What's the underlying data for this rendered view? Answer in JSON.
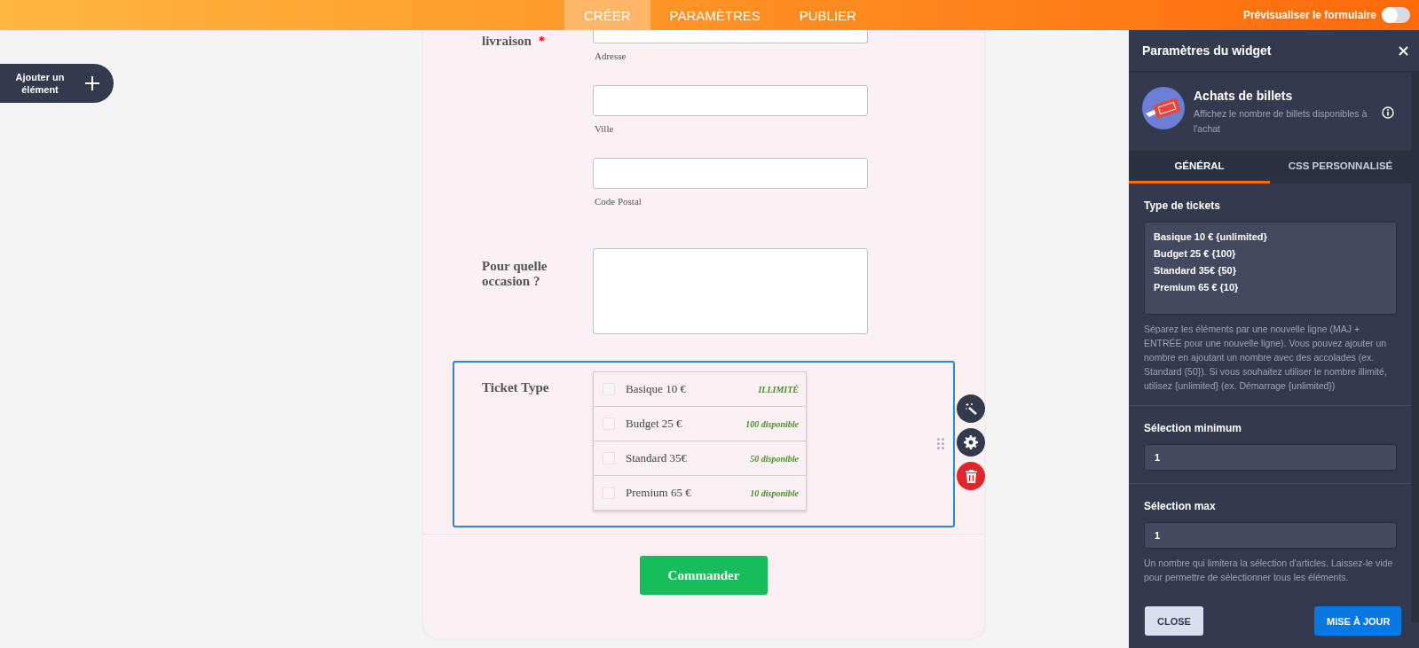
{
  "header": {
    "tabs": [
      {
        "label": "CRÉER",
        "selected": true
      },
      {
        "label": "PARAMÈTRES",
        "selected": false
      },
      {
        "label": "PUBLIER",
        "selected": false
      }
    ],
    "preview_toggle": {
      "label": "Prévisualiser le formulaire",
      "on": false
    }
  },
  "add_element_button": "Ajouter un élément",
  "form": {
    "fields": [
      {
        "kind": "address",
        "label": "livraison",
        "required_mark": "*",
        "inputs": [
          {
            "sublabel": "Adresse"
          },
          {
            "sublabel": "Ville"
          },
          {
            "sublabel": "Code Postal"
          }
        ]
      },
      {
        "kind": "textarea",
        "label": "Pour quelle occasion ?"
      },
      {
        "kind": "tickets",
        "label": "Ticket Type",
        "selected": true,
        "options": [
          {
            "name": "Basique 10 €",
            "availability": "ILLIMITÉ",
            "checked": false
          },
          {
            "name": "Budget 25 €",
            "availability": "100 disponible",
            "checked": false
          },
          {
            "name": "Standard 35€",
            "availability": "50 disponible",
            "checked": false
          },
          {
            "name": "Premium 65 €",
            "availability": "10 disponible",
            "checked": false
          }
        ]
      }
    ],
    "submit": "Commander"
  },
  "widget_panel": {
    "title": "Paramètres du widget",
    "widget": {
      "name": "Achats de billets",
      "description": "Affichez le nombre de billets disponibles à l'achat"
    },
    "tabs": [
      {
        "label": "GÉNÉRAL",
        "selected": true
      },
      {
        "label": "CSS PERSONNALISÉ",
        "selected": false
      }
    ],
    "sections": [
      {
        "kind": "textarea",
        "label": "Type de tickets",
        "lines": [
          "Basique 10 € {unlimited}",
          "Budget 25 € {100}",
          "Standard 35€ {50}",
          "Premium 65 € {10}"
        ],
        "help": "Séparez les éléments par une nouvelle ligne (MAJ + ENTRÉE pour une nouvelle ligne). Vous pouvez ajouter un nombre en ajoutant un nombre avec des accolades (ex. Standard {50}). Si vous souhaitez utiliser le nombre illimité, utilisez {unlimited} (ex. Démarrage {unlimited})"
      },
      {
        "kind": "input",
        "label": "Sélection minimum",
        "value": "1"
      },
      {
        "kind": "input",
        "label": "Sélection max",
        "value": "1",
        "help": "Un nombre qui limitera la sélection d'articles. Laissez-le vide pour permettre de sélectionner tous les éléments."
      }
    ],
    "buttons": [
      {
        "label": "CLOSE",
        "kind": "secondary"
      },
      {
        "label": "MISE À JOUR",
        "kind": "primary"
      }
    ]
  }
}
